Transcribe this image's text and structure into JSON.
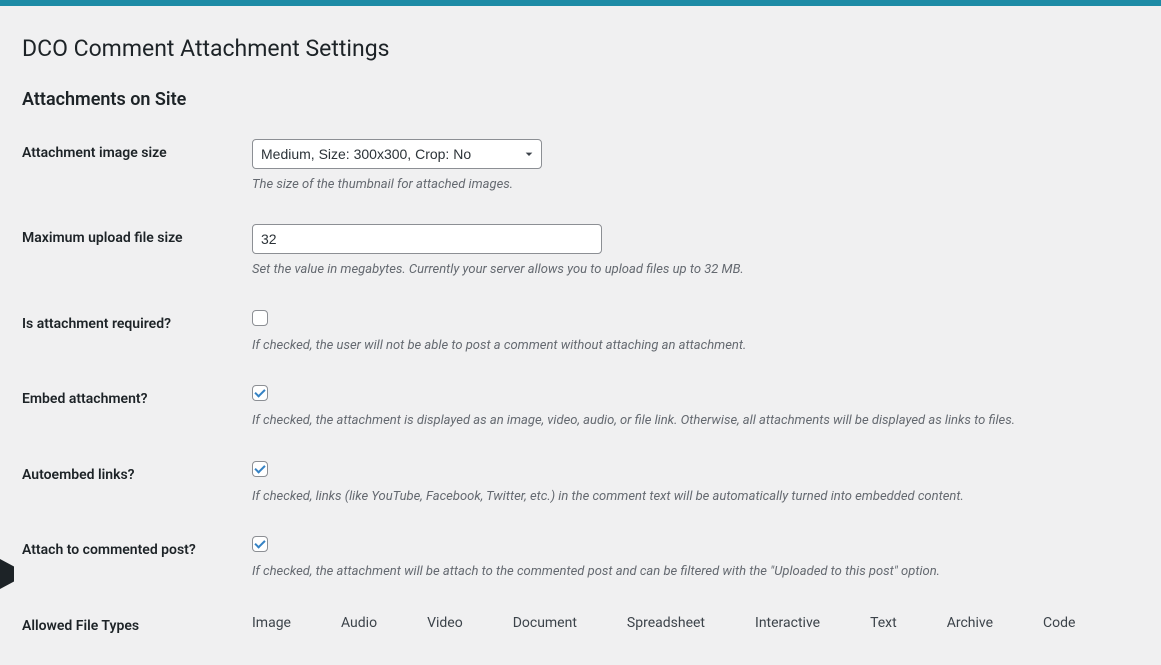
{
  "page": {
    "title": "DCO Comment Attachment Settings"
  },
  "section": {
    "title": "Attachments on Site"
  },
  "fields": {
    "image_size": {
      "label": "Attachment image size",
      "value": "Medium, Size: 300x300, Crop: No",
      "description": "The size of the thumbnail for attached images."
    },
    "max_upload": {
      "label": "Maximum upload file size",
      "value": "32",
      "description": "Set the value in megabytes. Currently your server allows you to upload files up to 32 MB."
    },
    "required": {
      "label": "Is attachment required?",
      "checked": false,
      "description": "If checked, the user will not be able to post a comment without attaching an attachment."
    },
    "embed": {
      "label": "Embed attachment?",
      "checked": true,
      "description": "If checked, the attachment is displayed as an image, video, audio, or file link. Otherwise, all attachments will be displayed as links to files."
    },
    "autoembed": {
      "label": "Autoembed links?",
      "checked": true,
      "description": "If checked, links (like YouTube, Facebook, Twitter, etc.) in the comment text will be automatically turned into embedded content."
    },
    "attach_post": {
      "label": "Attach to commented post?",
      "checked": true,
      "description": "If checked, the attachment will be attach to the commented post and can be filtered with the \"Uploaded to this post\" option."
    },
    "file_types": {
      "label": "Allowed File Types",
      "columns": [
        "Image",
        "Audio",
        "Video",
        "Document",
        "Spreadsheet",
        "Interactive",
        "Text",
        "Archive",
        "Code"
      ]
    }
  }
}
